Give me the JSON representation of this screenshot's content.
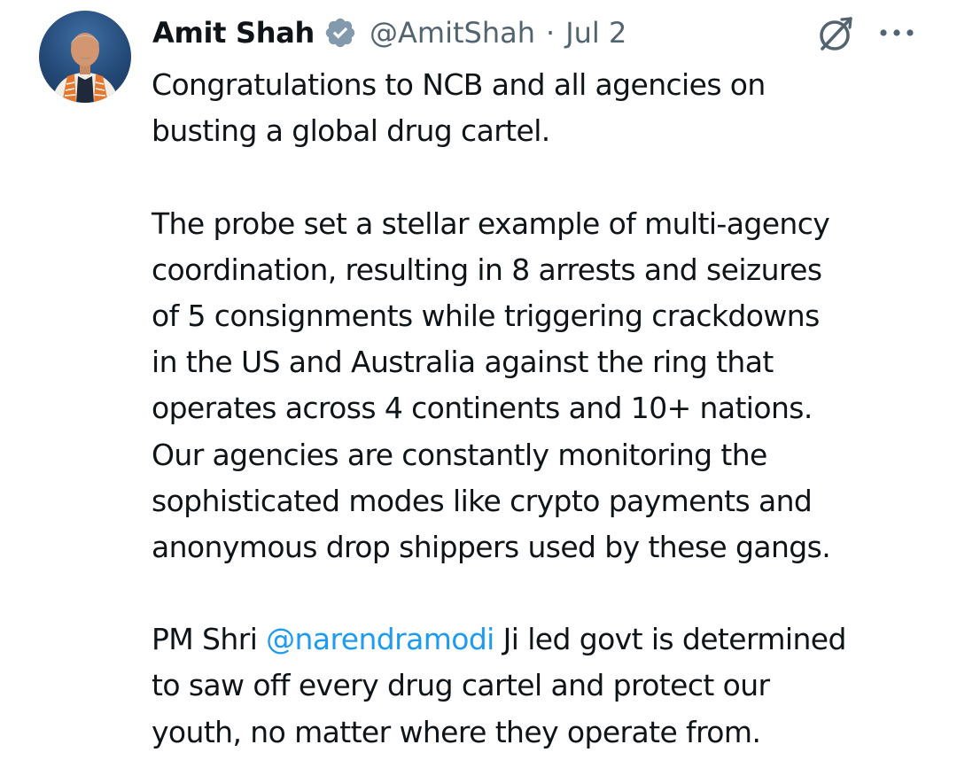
{
  "author": {
    "name": "Amit Shah",
    "handle": "@AmitShah",
    "separator": "·",
    "date": "Jul 2"
  },
  "icons": {
    "avatar": "profile-photo",
    "verified": "verified-badge-icon",
    "grok": "grok-icon",
    "more": "more-options-icon"
  },
  "colors": {
    "text": "#0f1419",
    "secondary": "#536471",
    "link": "#1d9bf0",
    "verified_badge": "#829aab"
  },
  "tweet": {
    "p1": [
      "Congratulations to NCB and all agencies on",
      "busting a global drug cartel."
    ],
    "p2": [
      "The probe set a stellar example of multi-agency",
      "coordination, resulting in 8 arrests and seizures",
      "of 5 consignments while triggering crackdowns",
      "in the US and Australia against the ring that",
      "operates across 4 continents and 10+ nations.",
      "Our agencies are constantly monitoring the",
      "sophisticated modes like crypto payments and",
      "anonymous drop shippers used by these gangs."
    ],
    "p3": {
      "prefix": "PM Shri ",
      "mention": "@narendramodi",
      "suffix": " Ji led govt is determined",
      "line2": "to saw off every drug cartel and protect our",
      "line3": "youth, no matter where they operate from."
    }
  }
}
